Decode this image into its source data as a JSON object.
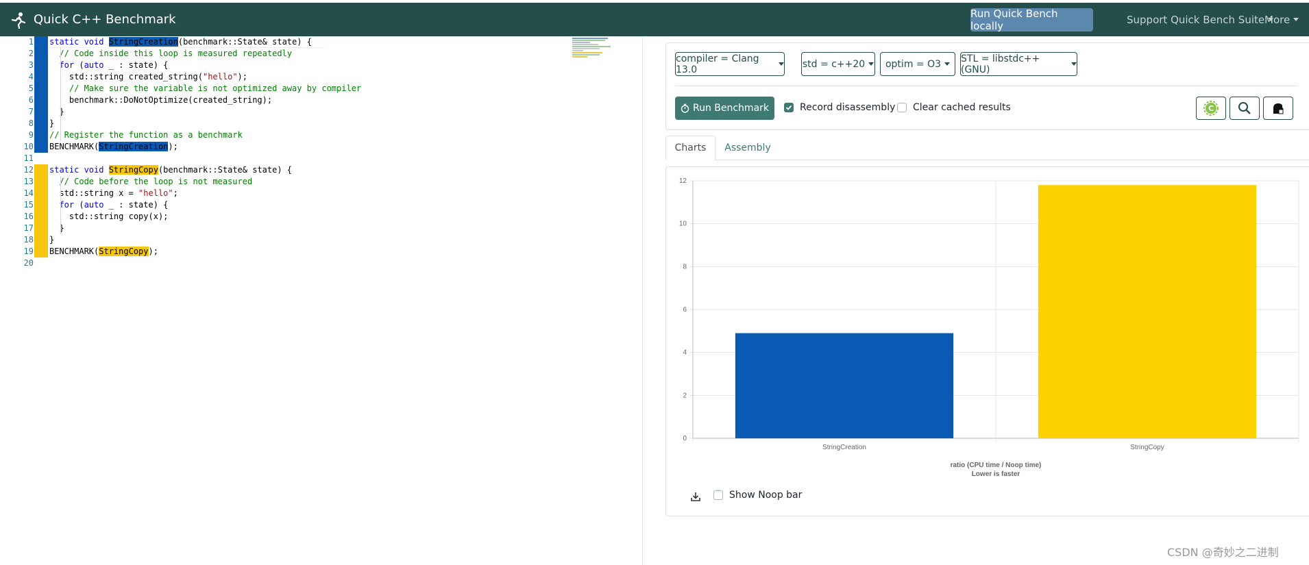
{
  "navbar": {
    "brand": "Quick C++ Benchmark",
    "run_local": "Run Quick Bench locally",
    "support": "Support Quick Bench Suite",
    "more": "More"
  },
  "editor": {
    "lines": [
      {
        "n": "1"
      },
      {
        "n": "2"
      },
      {
        "n": "3"
      },
      {
        "n": "4"
      },
      {
        "n": "5"
      },
      {
        "n": "6"
      },
      {
        "n": "7"
      },
      {
        "n": "8"
      },
      {
        "n": "9"
      },
      {
        "n": "10"
      },
      {
        "n": "11"
      },
      {
        "n": "12"
      },
      {
        "n": "13"
      },
      {
        "n": "14"
      },
      {
        "n": "15"
      },
      {
        "n": "16"
      },
      {
        "n": "17"
      },
      {
        "n": "18"
      },
      {
        "n": "19"
      },
      {
        "n": "20"
      }
    ],
    "code": {
      "l1_kw": "static void ",
      "l1_fn": "StringCreation",
      "l1_rest": "(benchmark::State& state) {",
      "l2": "  // Code inside this loop is measured repeatedly",
      "l3_kw1": "  for",
      "l3_a": " (",
      "l3_kw2": "auto",
      "l3_b": " _ : state) {",
      "l4_a": "    std::string created_string(",
      "l4_str": "\"hello\"",
      "l4_b": ");",
      "l5": "    // Make sure the variable is not optimized away by compiler",
      "l6": "    benchmark::DoNotOptimize(created_string);",
      "l7": "  }",
      "l8": "}",
      "l9": "// Register the function as a benchmark",
      "l10_a": "BENCHMARK(",
      "l10_fn": "StringCreation",
      "l10_b": ");",
      "l12_kw": "static void ",
      "l12_fn": "StringCopy",
      "l12_rest": "(benchmark::State& state) {",
      "l13": "  // Code before the loop is not measured",
      "l14_a": "  std::string x = ",
      "l14_str": "\"hello\"",
      "l14_b": ";",
      "l15_kw1": "  for",
      "l15_a": " (",
      "l15_kw2": "auto",
      "l15_b": " _ : state) {",
      "l16": "    std::string copy(x);",
      "l17": "  }",
      "l18": "}",
      "l19_a": "BENCHMARK(",
      "l19_fn": "StringCopy",
      "l19_b": ");"
    }
  },
  "options": {
    "compiler": "compiler = Clang 13.0",
    "std": "std = c++20",
    "optim": "optim = O3",
    "stl": "STL = libstdc++(GNU)",
    "run_button": "Run Benchmark",
    "record_disassembly": "Record disassembly",
    "clear_cache": "Clear cached results"
  },
  "tabs": {
    "charts": "Charts",
    "assembly": "Assembly"
  },
  "colors": {
    "navbar": "#254d4a",
    "accent": "#3e7a71",
    "blue_series": "#0a5ab4",
    "yellow_series": "#fdd000"
  },
  "chart_data": {
    "type": "bar",
    "categories": [
      "StringCreation",
      "StringCopy"
    ],
    "values": [
      4.9,
      11.8
    ],
    "colors": [
      "#0a5ab4",
      "#fdd000"
    ],
    "xlabel": "ratio (CPU time / Noop time)",
    "xlabel2": "Lower is faster",
    "ylim": [
      0,
      12
    ],
    "yticks": [
      "0",
      "2",
      "4",
      "6",
      "8",
      "10",
      "12"
    ],
    "grid": true
  },
  "chart_footer": {
    "show_noop": "Show Noop bar"
  },
  "watermark": "CSDN @奇妙之二进制"
}
